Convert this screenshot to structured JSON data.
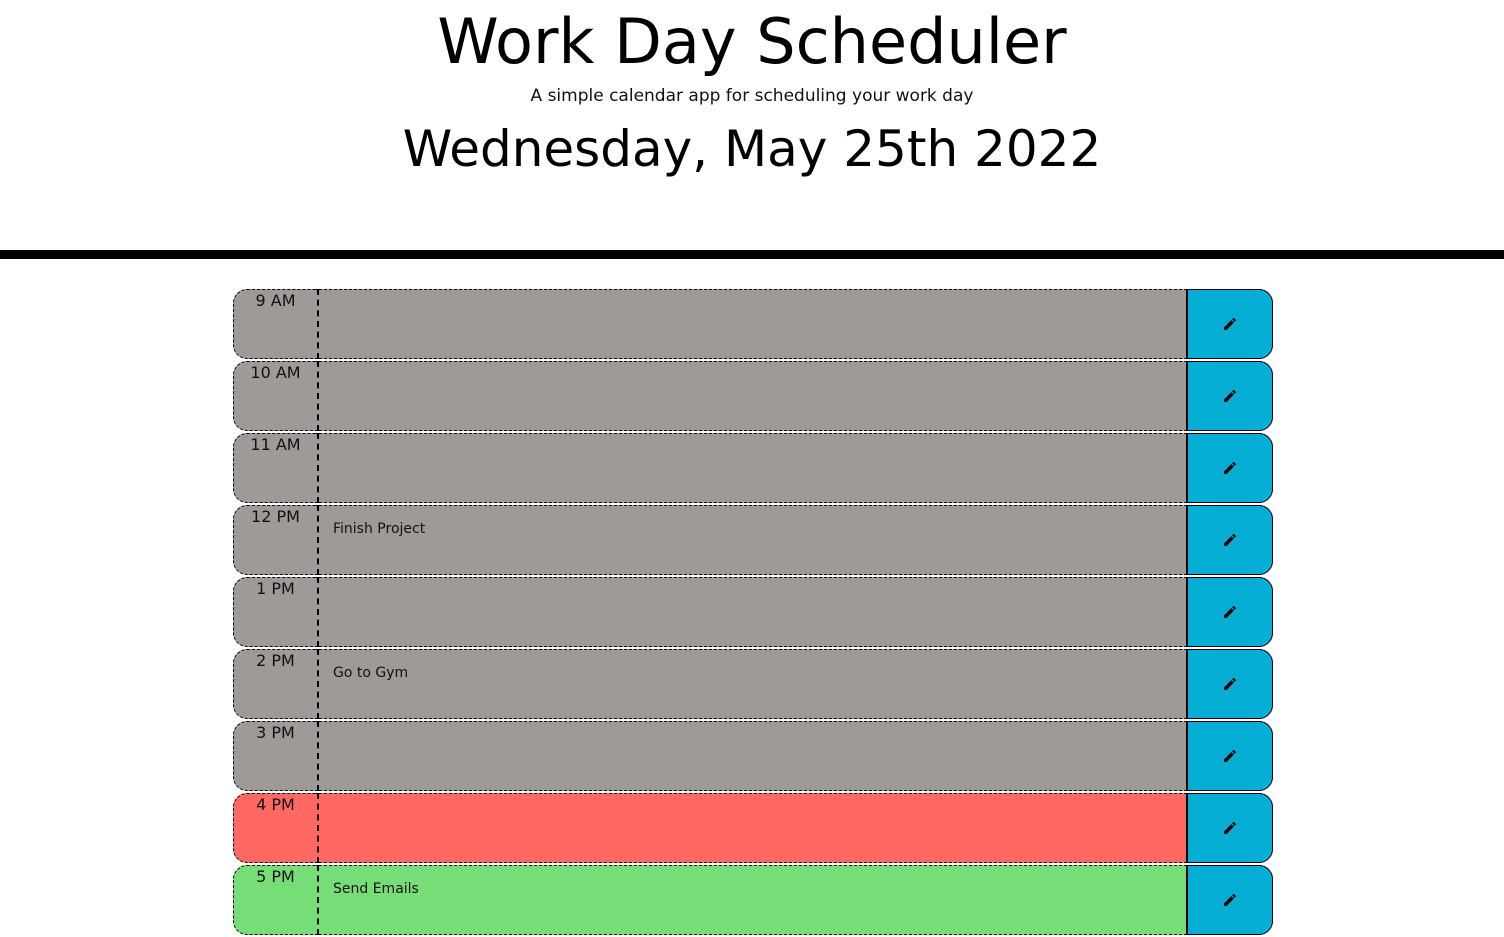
{
  "header": {
    "title": "Work Day Scheduler",
    "subtitle": "A simple calendar app for scheduling your work day",
    "current_day": "Wednesday, May 25th 2022"
  },
  "colors": {
    "past": "#9f9a98",
    "present": "#ff6961",
    "future": "#77dd77",
    "save": "#06aed5"
  },
  "rows": [
    {
      "hour": "9 AM",
      "text": "",
      "status": "past",
      "icon": "pencil-icon"
    },
    {
      "hour": "10 AM",
      "text": "",
      "status": "past",
      "icon": "pencil-icon"
    },
    {
      "hour": "11 AM",
      "text": "",
      "status": "past",
      "icon": "pencil-icon"
    },
    {
      "hour": "12 PM",
      "text": "Finish Project",
      "status": "past",
      "icon": "pencil-icon"
    },
    {
      "hour": "1 PM",
      "text": "",
      "status": "past",
      "icon": "pencil-icon"
    },
    {
      "hour": "2 PM",
      "text": "Go to Gym",
      "status": "past",
      "icon": "pencil-icon"
    },
    {
      "hour": "3 PM",
      "text": "",
      "status": "past",
      "icon": "pencil-icon"
    },
    {
      "hour": "4 PM",
      "text": "",
      "status": "present",
      "icon": "pencil-icon"
    },
    {
      "hour": "5 PM",
      "text": "Send Emails",
      "status": "future",
      "icon": "pencil-icon"
    }
  ]
}
